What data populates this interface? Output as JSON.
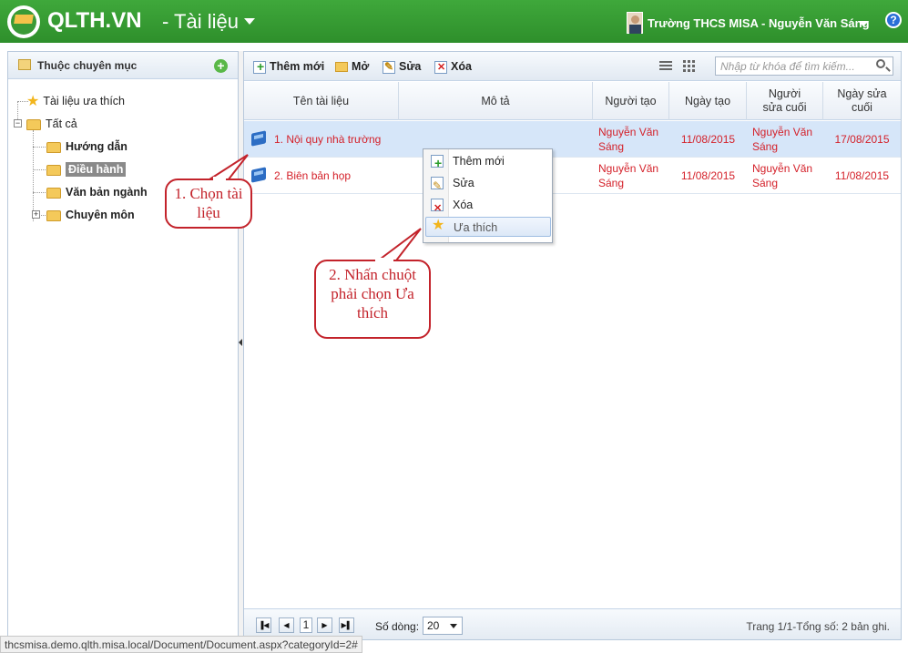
{
  "header": {
    "brand": "QLTH.VN",
    "module": "- Tài liệu",
    "user": "Trường THCS MISA - Nguyễn Văn Sáng",
    "help": "?"
  },
  "left_panel": {
    "title": "Thuộc chuyên mục",
    "tree": {
      "favorites": "Tài liệu ưa thích",
      "all": "Tất cả",
      "children": [
        "Hướng dẫn",
        "Điều hành",
        "Văn bản ngành",
        "Chuyên môn"
      ],
      "selected": "Điều hành"
    }
  },
  "toolbar": {
    "add": "Thêm mới",
    "open": "Mở",
    "edit": "Sửa",
    "delete": "Xóa",
    "search_placeholder": "Nhập từ khóa để tìm kiếm..."
  },
  "grid": {
    "columns": [
      "Tên tài liệu",
      "Mô tả",
      "Người tạo",
      "Ngày tạo",
      "Người sửa cuối",
      "Ngày sửa cuối"
    ],
    "rows": [
      {
        "name": "1. Nội quy nhà trường",
        "desc": "",
        "creator": "Nguyễn Văn Sáng",
        "created": "11/08/2015",
        "editor": "Nguyễn Văn Sáng",
        "edited": "17/08/2015"
      },
      {
        "name": "2. Biên bản họp",
        "desc": "",
        "creator": "Nguyễn Văn Sáng",
        "created": "11/08/2015",
        "editor": "Nguyễn Văn Sáng",
        "edited": "11/08/2015"
      }
    ]
  },
  "footer": {
    "page": "1",
    "rows_label": "Số dòng:",
    "rows_value": "20",
    "page_info": "Trang 1/1-Tổng số: 2 bản ghi."
  },
  "context_menu": {
    "items": [
      "Thêm mới",
      "Sửa",
      "Xóa",
      "Ưa thích"
    ]
  },
  "callouts": {
    "step1": "1. Chọn tài liệu",
    "step2": "2. Nhấn chuột phải chọn Ưa thích"
  },
  "status_bar": "thcsmisa.demo.qlth.misa.local/Document/Document.aspx?categoryId=2#",
  "colors": {
    "header_green": "#3fa83b",
    "row_text_red": "#d4212a",
    "callout_red": "#c3232b",
    "selected_row": "#d6e6f9"
  }
}
